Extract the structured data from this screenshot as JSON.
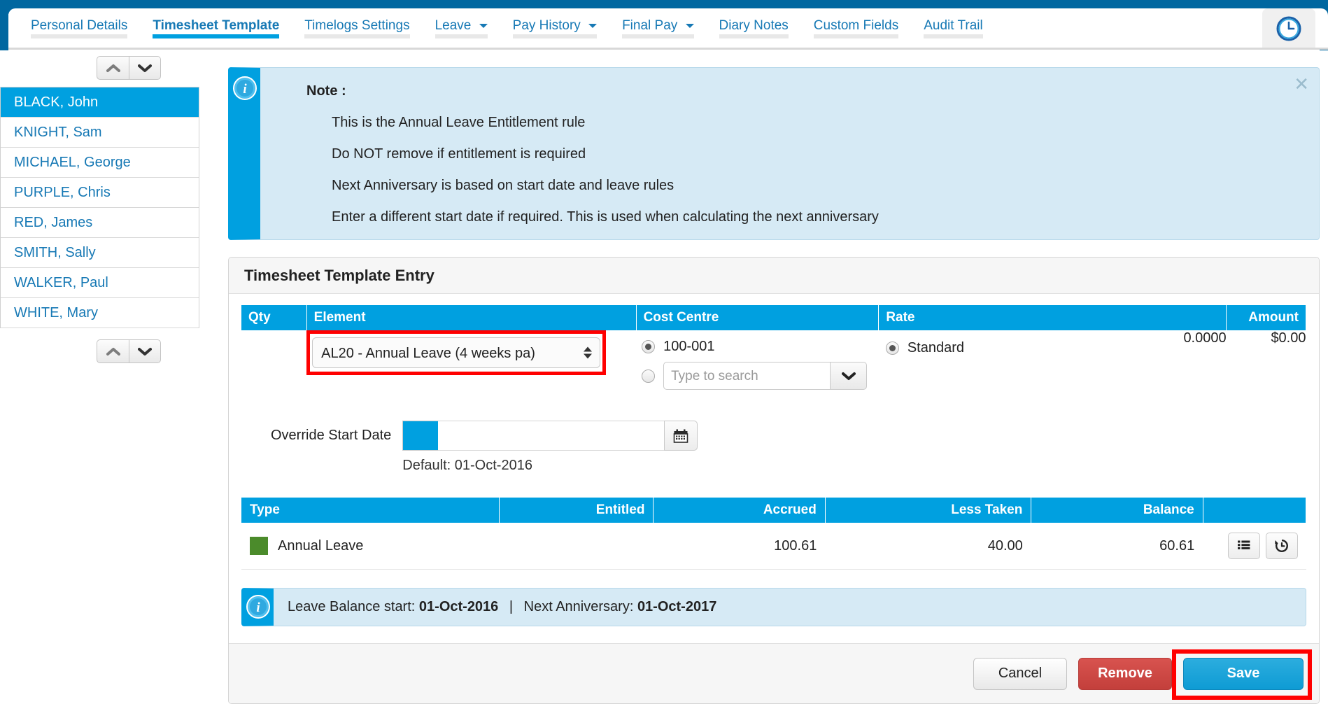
{
  "nav": {
    "tabs": [
      {
        "label": "Personal Details",
        "has_caret": false,
        "active": false
      },
      {
        "label": "Timesheet Template",
        "has_caret": false,
        "active": true
      },
      {
        "label": "Timelogs Settings",
        "has_caret": false,
        "active": false
      },
      {
        "label": "Leave",
        "has_caret": true,
        "active": false
      },
      {
        "label": "Pay History",
        "has_caret": true,
        "active": false
      },
      {
        "label": "Final Pay",
        "has_caret": true,
        "active": false
      },
      {
        "label": "Diary Notes",
        "has_caret": false,
        "active": false
      },
      {
        "label": "Custom Fields",
        "has_caret": false,
        "active": false
      },
      {
        "label": "Audit Trail",
        "has_caret": false,
        "active": false
      }
    ],
    "clock_icon": "clock-icon"
  },
  "sidebar": {
    "top_arrows": {
      "up": "chevron-up-icon",
      "down": "chevron-down-icon"
    },
    "bottom_arrows": {
      "up": "chevron-up-icon",
      "down": "chevron-down-icon"
    },
    "employees": [
      {
        "name": "BLACK, John",
        "selected": true
      },
      {
        "name": "KNIGHT, Sam",
        "selected": false
      },
      {
        "name": "MICHAEL, George",
        "selected": false
      },
      {
        "name": "PURPLE, Chris",
        "selected": false
      },
      {
        "name": "RED, James",
        "selected": false
      },
      {
        "name": "SMITH, Sally",
        "selected": false
      },
      {
        "name": "WALKER, Paul",
        "selected": false
      },
      {
        "name": "WHITE, Mary",
        "selected": false
      }
    ]
  },
  "note": {
    "icon": "info-icon",
    "title": "Note :",
    "lines": [
      "This is the Annual Leave Entitlement rule",
      "Do NOT remove if entitlement is required",
      "Next Anniversary is based on start date and leave rules",
      "Enter a different start date if required. This is used when calculating the next anniversary"
    ],
    "close_label": "✕"
  },
  "panel": {
    "title": "Timesheet Template Entry",
    "entry_table": {
      "headers": [
        "Qty",
        "Element",
        "Cost Centre",
        "Rate",
        "Amount"
      ],
      "element_value": "AL20 - Annual Leave (4 weeks pa)",
      "cost_centre": {
        "option_value": "100-001",
        "option_selected": true,
        "search_selected": false,
        "search_placeholder": "Type to search",
        "dropdown_icon": "chevron-down-icon"
      },
      "rate": {
        "label": "Standard",
        "selected": true,
        "value": "0.0000"
      },
      "amount": "$0.00",
      "qty": ""
    },
    "override": {
      "label": "Override Start Date",
      "value": "",
      "calendar_icon": "calendar-icon",
      "default_text": "Default: 01-Oct-2016"
    },
    "balance_table": {
      "headers": [
        "Type",
        "Entitled",
        "Accrued",
        "Less Taken",
        "Balance",
        ""
      ],
      "rows": [
        {
          "swatch_color": "#4b8b2b",
          "type": "Annual Leave",
          "entitled": "",
          "accrued": "100.61",
          "less_taken": "40.00",
          "balance": "60.61",
          "actions": [
            {
              "icon": "list-icon"
            },
            {
              "icon": "history-icon"
            }
          ]
        }
      ]
    },
    "balance_bar": {
      "icon": "info-icon",
      "label_start": "Leave Balance start:",
      "value_start": "01-Oct-2016",
      "separator": "|",
      "label_next": "Next Anniversary:",
      "value_next": "01-Oct-2017"
    },
    "footer": {
      "cancel_label": "Cancel",
      "remove_label": "Remove",
      "save_label": "Save"
    }
  },
  "colors": {
    "brand_blue": "#00a0e0",
    "dark_blue": "#0067a0",
    "link_blue": "#1779b5",
    "note_bg": "#d6eaf5",
    "danger_red": "#c33f3b",
    "highlight_red": "#ff0000",
    "leave_green": "#4b8b2b"
  }
}
